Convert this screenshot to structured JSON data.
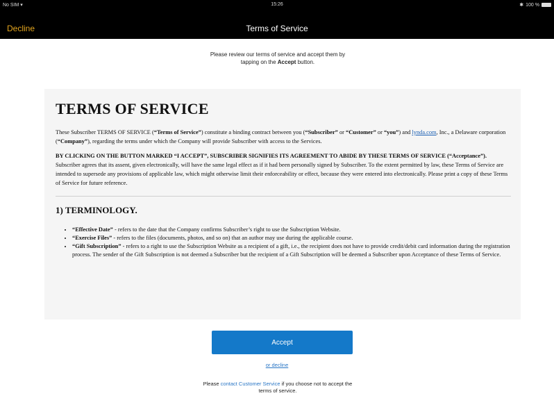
{
  "status_bar": {
    "carrier": "No SIM ▾",
    "time": "15:26",
    "battery": "100 %"
  },
  "nav": {
    "decline_label": "Decline",
    "title": "Terms of Service"
  },
  "intro": {
    "text_before": "Please review our terms of service and accept them by tapping on the ",
    "accept_word": "Accept",
    "text_after": " button."
  },
  "tos": {
    "heading": "TERMS OF SERVICE",
    "p1": {
      "a": "These Subscriber TERMS OF SERVICE (",
      "b": "“Terms of Service”",
      "c": ") constitute a binding contract between you (",
      "d": "“Subscriber”",
      "e": " or ",
      "f": "“Customer”",
      "g": " or ",
      "h": "“you”",
      "i": ") and ",
      "link": "lynda.com",
      "j": ", Inc., a Delaware corporation (",
      "k": "“Company”",
      "l": "), regarding the terms under which the Company will provide Subscriber with access to the Services."
    },
    "p2": {
      "bold": "BY CLICKING ON THE BUTTON MARKED “I ACCEPT”, SUBSCRIBER SIGNIFIES ITS AGREEMENT TO ABIDE BY THESE TERMS OF SERVICE (“Acceptance”).",
      "rest": " Subscriber agrees that its assent, given electronically, will have the same legal effect as if it had been personally signed by Subscriber. To the extent permitted by law, these Terms of Service are intended to supersede any provisions of applicable law, which might otherwise limit their enforceability or effect, because they were entered into electronically. Please print a copy of these Terms of Service for future reference."
    },
    "section1_title": "1) TERMINOLOGY.",
    "terms": [
      {
        "term": "“Effective Date”",
        "def": " - refers to the date that the Company confirms Subscriber’s right to use the Subscription Website."
      },
      {
        "term": "“Exercise Files”",
        "def": " - refers to the files (documents, photos, and so on) that an author may use during the applicable course."
      },
      {
        "term": "“Gift Subscription”",
        "def": " - refers to a right to use the Subscription Website as a recipient of a gift, i.e., the recipient does not have to provide credit/debit card information during the registration process. The sender of the Gift Subscription is not deemed a Subscriber but the recipient of a Gift Subscription will be deemed a Subscriber upon Acceptance of these Terms of Service."
      }
    ]
  },
  "accept_button": "Accept",
  "or_decline": "or decline",
  "footer": {
    "before": "Please ",
    "link": "contact Customer Service",
    "after": " if you choose not to accept the terms of service."
  },
  "colors": {
    "accent": "#e3a51e",
    "button": "#1479c9",
    "link": "#2b77c6"
  }
}
